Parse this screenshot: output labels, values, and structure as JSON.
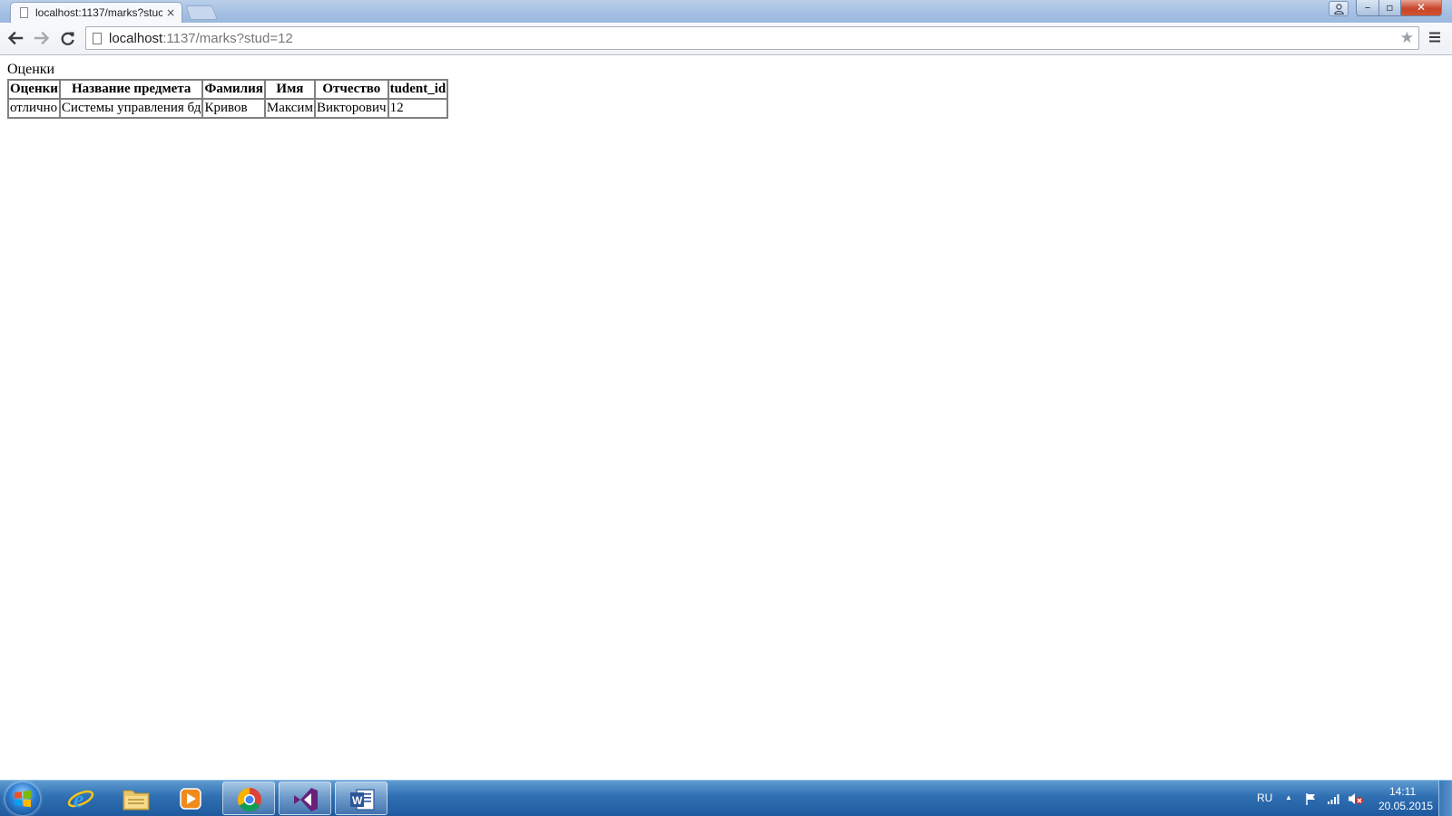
{
  "browser": {
    "tab_title": "localhost:1137/marks?stuc",
    "tab_close": "×",
    "url_host": "localhost",
    "url_rest": ":1137/marks?stud=12",
    "icons": {
      "back": "back-arrow-icon",
      "forward": "forward-arrow-icon",
      "reload": "reload-icon",
      "star": "bookmark-star-icon",
      "menu": "hamburger-menu-icon"
    }
  },
  "window_controls": {
    "minimize": "–",
    "maximize": "▫",
    "close": "✕"
  },
  "page": {
    "heading": "Оценки",
    "table": {
      "headers": [
        "Оценки",
        "Название предмета",
        "Фамилия",
        "Имя",
        "Отчество",
        "tudent_id"
      ],
      "rows": [
        [
          "отлично",
          "Системы управления бд",
          "Кривов",
          "Максим",
          "Викторович",
          "12"
        ]
      ]
    }
  },
  "taskbar": {
    "apps": [
      "internet-explorer",
      "file-explorer",
      "media-player",
      "chrome",
      "visual-studio",
      "word"
    ],
    "active_apps": [
      "chrome",
      "visual-studio",
      "word"
    ],
    "language": "RU",
    "tray_arrow": "▲",
    "time": "14:11",
    "date": "20.05.2015"
  }
}
